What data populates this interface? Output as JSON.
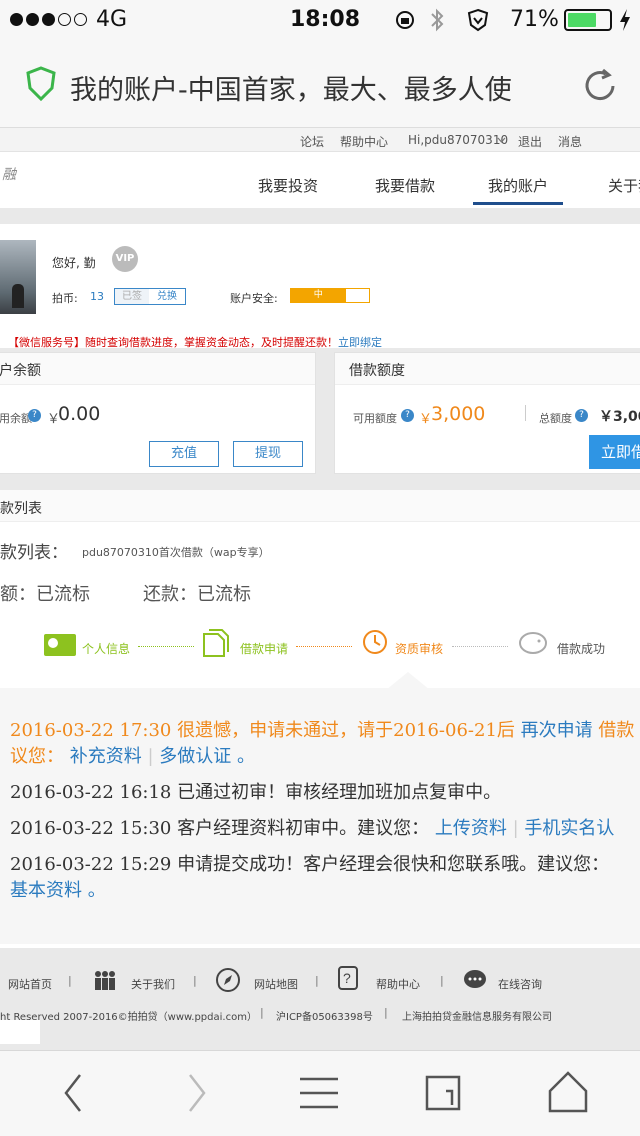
{
  "status_bar": {
    "carrier": "4G",
    "time": "18:08",
    "battery_percent": "71%",
    "battery_level": 0.71,
    "signal_bars_filled": 3
  },
  "browser": {
    "page_title": "我的账户-中国首家，最大、最多人使"
  },
  "site": {
    "top_links": [
      "论坛",
      "帮助中心",
      "Hi,pdu87070310",
      "退出",
      "消息"
    ],
    "nav": [
      "我要投资",
      "我要借款",
      "我的账户",
      "关于我"
    ],
    "active_nav": "我的账户",
    "logo_text": "融"
  },
  "profile": {
    "greeting": "您好,  勤",
    "coins_label": "拍币:",
    "coins_value": "13",
    "signed_label": "已签",
    "exchange_label": "兑换",
    "security_label": "账户安全:",
    "security_level": "中",
    "security_fraction": 0.7
  },
  "notice": {
    "text": "【微信服务号】随时查询借款进度，掌握资金动态，及时提醒还款！",
    "link": "立即绑定"
  },
  "balance_panel": {
    "title": "户余额",
    "label": "用余额",
    "currency": "￥",
    "amount": "0.00",
    "recharge": "充值",
    "withdraw": "提现"
  },
  "credit_panel": {
    "title": "借款额度",
    "available_label": "可用额度",
    "available_currency": "￥",
    "available_amount": "3,000",
    "total_label": "总额度",
    "total_amount": "￥3,00",
    "borrow_button": "立即借"
  },
  "loan": {
    "section_title": "款列表",
    "list_label": "款列表：",
    "loan_name": "pdu87070310首次借款（wap专享）",
    "amount_label": "额：已流标",
    "repay_label": "还款：已流标",
    "steps": [
      "个人信息",
      "借款申请",
      "资质审核",
      "借款成功"
    ]
  },
  "timeline": {
    "entries": [
      {
        "time": "2016-03-22 17:30",
        "text": "很遗憾，申请未通过，请于2016-06-21后",
        "link1": "再次申请",
        "text2": "借款",
        "line2_prefix": "议您：",
        "link2": "补充资料",
        "link3": "多做认证",
        "suffix": "。"
      },
      {
        "time": "2016-03-22 16:18",
        "text": "已通过初审！审核经理加班加点复审中。"
      },
      {
        "time": "2016-03-22 15:30",
        "text": "客户经理资料初审中。建议您：",
        "link1": "上传资料",
        "link2": "手机实名认"
      },
      {
        "time": "2016-03-22 15:29",
        "text": "申请提交成功！客户经理会很快和您联系哦。建议您：",
        "link1": "基本资料",
        "suffix": "。"
      }
    ]
  },
  "footer": {
    "links": [
      "网站首页",
      "关于我们",
      "网站地图",
      "帮助中心",
      "在线咨询"
    ],
    "copyright": "ht Reserved 2007-2016©拍拍贷（www.ppdai.com）",
    "icp": "沪ICP备05063398号",
    "company": "上海拍拍贷金融信息服务有限公司"
  },
  "colors": {
    "accent_blue": "#2b7bbf",
    "orange": "#f0891c",
    "green": "#8dc21f",
    "red": "#d40000",
    "battery_green": "#4cd964"
  }
}
